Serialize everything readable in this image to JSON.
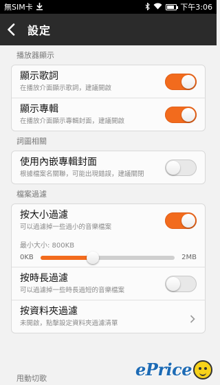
{
  "status_bar": {
    "carrier": "無SIM卡",
    "time": "下午3:06",
    "battery_level": 0.85
  },
  "header": {
    "title": "設定"
  },
  "sections": [
    {
      "label": "播放器顯示",
      "rows": [
        {
          "title": "顯示歌詞",
          "subtitle": "在播放介面顯示歌詞，建議開啟",
          "toggle": true
        },
        {
          "title": "顯示專輯",
          "subtitle": "在播放介面顯示專輯封面，建議開啟",
          "toggle": true
        }
      ]
    },
    {
      "label": "詞圖相關",
      "rows": [
        {
          "title": "使用內嵌專輯封面",
          "subtitle": "根據檔案名關聯，可能出現錯誤，建議關閉",
          "toggle": false
        }
      ]
    },
    {
      "label": "檔案過濾",
      "rows": [
        {
          "title": "按大小過濾",
          "subtitle": "可以過濾掉一些過小的音樂檔案",
          "toggle": true
        },
        {
          "title": "按時長過濾",
          "subtitle": "可以過濾掉一些時長過短的音樂檔案",
          "toggle": false
        },
        {
          "title": "按資料夾過濾",
          "subtitle": "未開啟，點擊設定資料夾過濾清單"
        }
      ],
      "slider": {
        "caption": "最小大小: 800KB",
        "min_label": "0KB",
        "max_label": "2MB",
        "value_fraction": 0.39
      }
    },
    {
      "label": "甩動切歌"
    }
  ],
  "watermark": {
    "text": "ePrice"
  },
  "colors": {
    "accent": "#f26b1d",
    "header_bg": "#2b2b2b",
    "watermark_blue": "#1d6bb5"
  }
}
